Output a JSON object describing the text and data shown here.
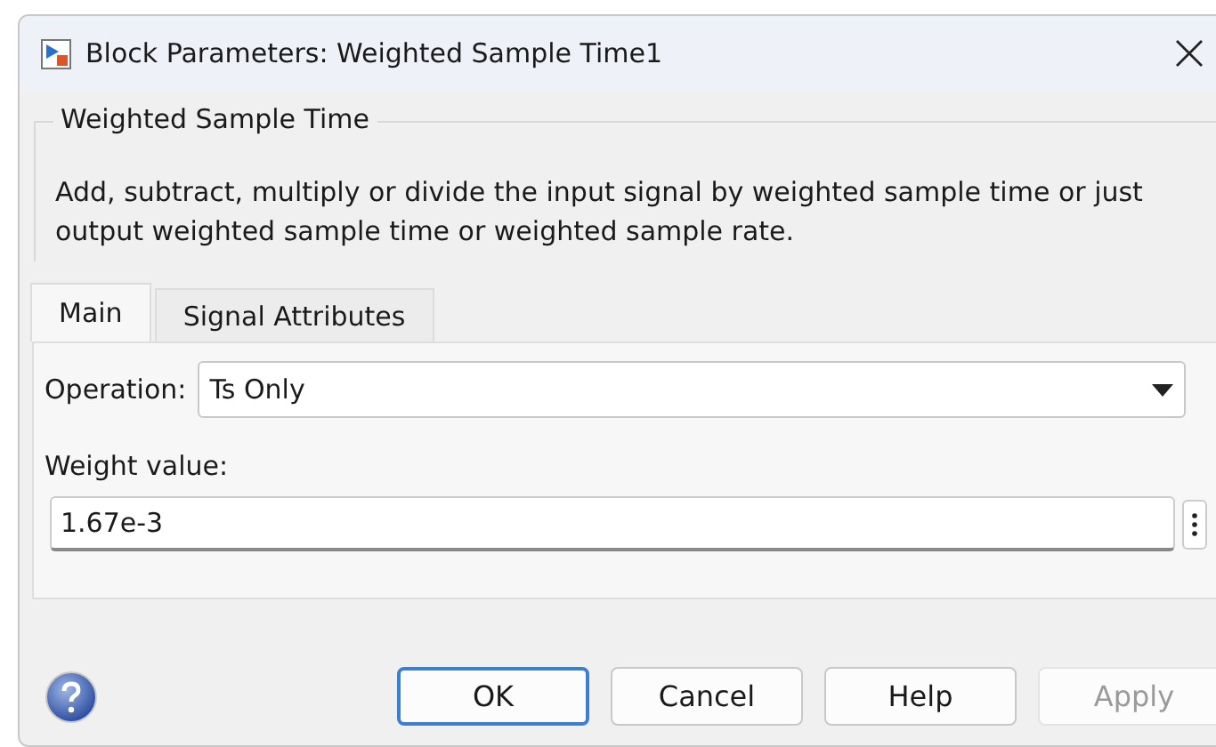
{
  "window": {
    "title": "Block Parameters: Weighted Sample Time1"
  },
  "group": {
    "title": "Weighted Sample Time",
    "description": "Add, subtract, multiply or divide the input signal by weighted sample time or just output weighted sample time or weighted sample rate."
  },
  "tabs": [
    {
      "label": "Main",
      "selected": true
    },
    {
      "label": "Signal Attributes",
      "selected": false
    }
  ],
  "operation": {
    "label": "Operation:",
    "value": "Ts Only"
  },
  "weight": {
    "label": "Weight value:",
    "value": "1.67e-3"
  },
  "buttons": [
    {
      "label": "OK",
      "default": true,
      "disabled": false
    },
    {
      "label": "Cancel",
      "default": false,
      "disabled": false
    },
    {
      "label": "Help",
      "default": false,
      "disabled": false
    },
    {
      "label": "Apply",
      "default": false,
      "disabled": true
    }
  ]
}
